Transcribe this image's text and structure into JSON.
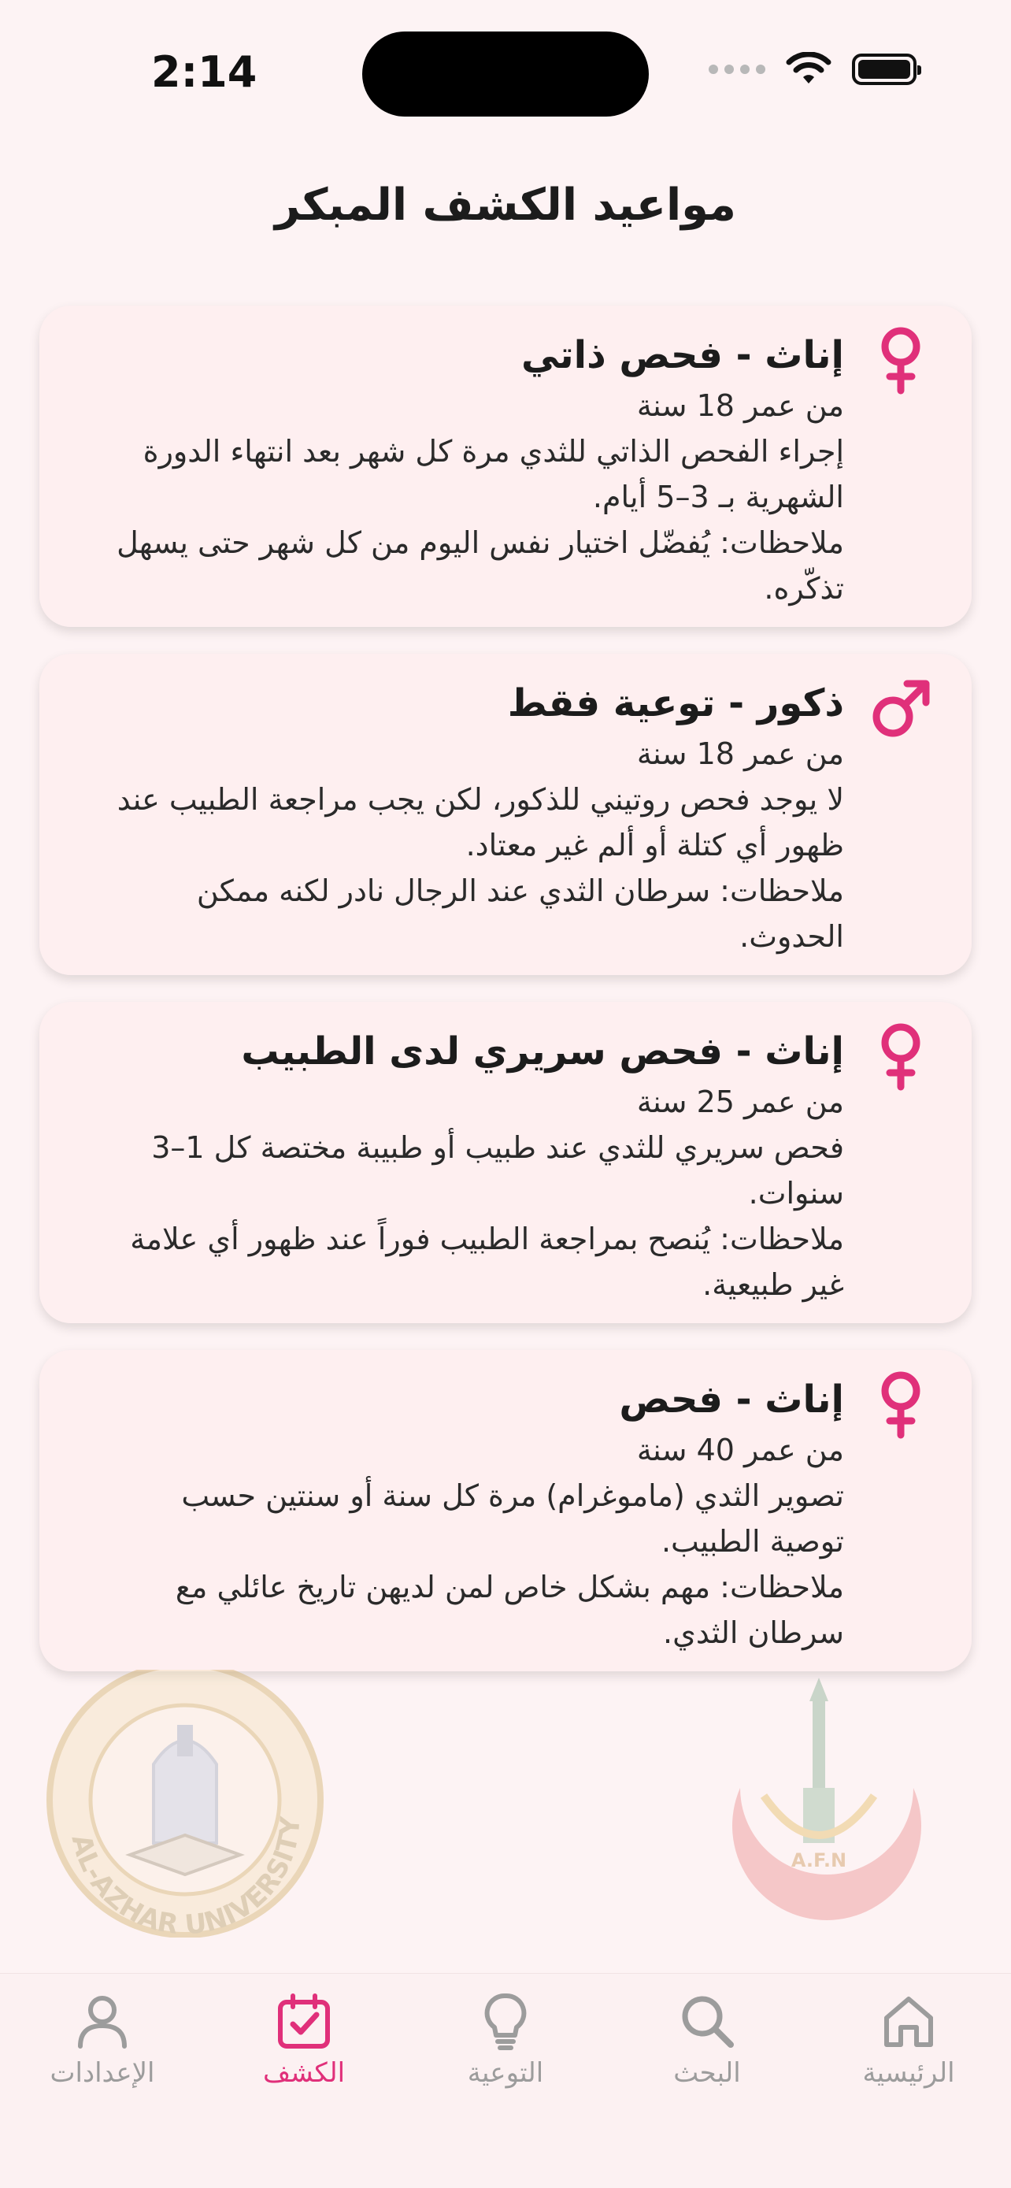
{
  "status_bar": {
    "time": "2:14"
  },
  "page": {
    "title": "مواعيد الكشف المبكر"
  },
  "cards": [
    {
      "icon": "female-icon",
      "title": "إناث - فحص ذاتي",
      "age": "من عمر 18 سنة",
      "description": "إجراء الفحص الذاتي للثدي مرة كل شهر بعد انتهاء الدورة الشهرية بـ 3–5 أيام.",
      "notes": "ملاحظات: يُفضّل اختيار نفس اليوم من كل شهر حتى يسهل تذكّره."
    },
    {
      "icon": "male-icon",
      "title": "ذكور - توعية فقط",
      "age": "من عمر 18 سنة",
      "description": "لا يوجد فحص روتيني للذكور، لكن يجب مراجعة الطبيب عند ظهور أي كتلة أو ألم غير معتاد.",
      "notes": "ملاحظات: سرطان الثدي عند الرجال نادر لكنه ممكن الحدوث."
    },
    {
      "icon": "female-icon",
      "title": "إناث - فحص سريري لدى الطبيب",
      "age": "من عمر 25 سنة",
      "description": "فحص سريري للثدي عند طبيب أو طبيبة مختصة كل 1–3 سنوات.",
      "notes": "ملاحظات: يُنصح بمراجعة الطبيب فوراً عند ظهور أي علامة غير طبيعية."
    },
    {
      "icon": "female-icon",
      "title": "إناث - فحص",
      "age": "من عمر 40 سنة",
      "description": "تصوير الثدي (ماموغرام) مرة كل سنة أو سنتين حسب توصية الطبيب.",
      "notes": "ملاحظات: مهم بشكل خاص لمن لديهن تاريخ عائلي مع سرطان الثدي."
    }
  ],
  "logos": {
    "left_logo_text": "AL-AZHAR UNIVERSITY",
    "right_logo_text": "A.F.N"
  },
  "tabs": [
    {
      "label": "الرئيسية",
      "icon": "home-icon",
      "active": false
    },
    {
      "label": "البحث",
      "icon": "search-icon",
      "active": false
    },
    {
      "label": "التوعية",
      "icon": "lightbulb-icon",
      "active": false
    },
    {
      "label": "الكشف",
      "icon": "calendar-check-icon",
      "active": true
    },
    {
      "label": "الإعدادات",
      "icon": "person-icon",
      "active": false
    }
  ],
  "colors": {
    "accent": "#e0307a",
    "background": "#fdf3f4",
    "card": "#feeff0",
    "tab_inactive": "#9c9c9c"
  }
}
